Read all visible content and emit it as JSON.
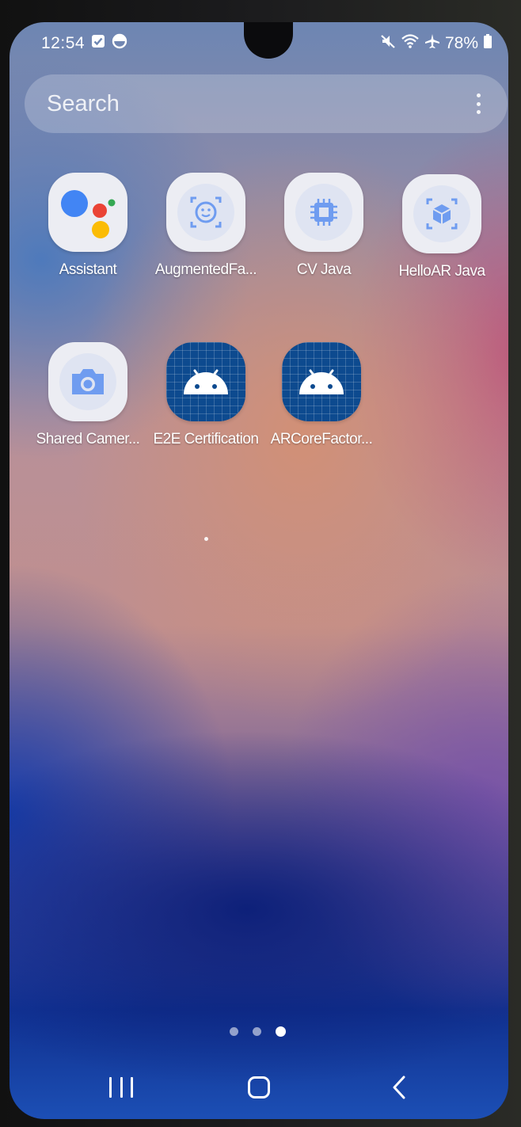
{
  "status_bar": {
    "time": "12:54",
    "left_icons": [
      "checkbox-notification-icon",
      "data-saver-icon"
    ],
    "right_icons": [
      "mute-icon",
      "wifi-icon",
      "airplane-icon",
      "battery-icon"
    ],
    "battery_percent": "78%"
  },
  "search": {
    "placeholder": "Search",
    "more_icon": "more-vertical-icon"
  },
  "apps": [
    {
      "label": "Assistant",
      "icon": "google-assistant-icon"
    },
    {
      "label": "AugmentedFa...",
      "icon": "face-tracking-icon"
    },
    {
      "label": "CV Java",
      "icon": "chip-icon"
    },
    {
      "label": "HelloAR Java",
      "icon": "ar-cube-icon"
    },
    {
      "label": "Shared Camer...",
      "icon": "camera-icon"
    },
    {
      "label": "E2E Certification",
      "icon": "android-icon"
    },
    {
      "label": "ARCoreFactor...",
      "icon": "android-icon"
    }
  ],
  "pagination": {
    "pages": 3,
    "current_page": 3
  },
  "navigation": {
    "recent": "recent-apps-icon",
    "home": "home-icon",
    "back": "back-icon"
  },
  "colors": {
    "icon_background": "#ecedf3",
    "icon_accent": "#6f9cf0",
    "android_icon_background": "#0d4a8f"
  }
}
